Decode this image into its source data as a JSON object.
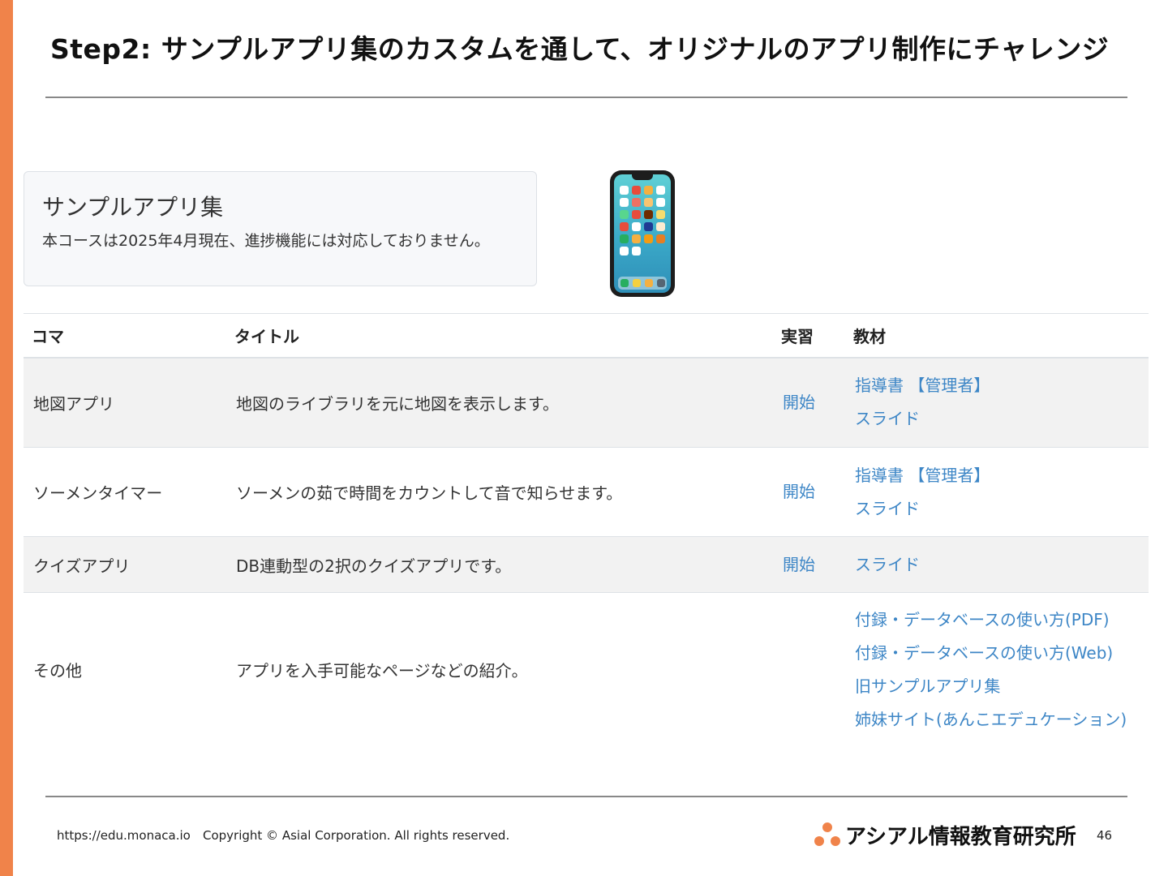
{
  "slide": {
    "title": "Step2: サンプルアプリ集のカスタムを通して、オリジナルのアプリ制作にチャレンジ",
    "accent_color": "#f0834a"
  },
  "info_box": {
    "heading": "サンプルアプリ集",
    "note": "本コースは2025年4月現在、進捗機能には対応しておりません。"
  },
  "phone_image": {
    "icon": "smartphone-home-screen-icon"
  },
  "table": {
    "headers": {
      "koma": "コマ",
      "title": "タイトル",
      "jissyu": "実習",
      "kyozai": "教材"
    },
    "rows": [
      {
        "koma": "地図アプリ",
        "title": "地図のライブラリを元に地図を表示します。",
        "start": "開始",
        "materials": [
          "指導書 【管理者】",
          "スライド"
        ]
      },
      {
        "koma": "ソーメンタイマー",
        "title": "ソーメンの茹で時間をカウントして音で知らせます。",
        "start": "開始",
        "materials": [
          "指導書 【管理者】",
          "スライド"
        ]
      },
      {
        "koma": "クイズアプリ",
        "title": "DB連動型の2択のクイズアプリです。",
        "start": "開始",
        "materials": [
          "スライド"
        ]
      },
      {
        "koma": "その他",
        "title": "アプリを入手可能なページなどの紹介。",
        "start": "",
        "materials": [
          "付録・データベースの使い方(PDF)",
          "付録・データベースの使い方(Web)",
          "旧サンプルアプリ集",
          "姉妹サイト(あんこエデュケーション)"
        ]
      }
    ],
    "link_color": "#3d86c6"
  },
  "footer": {
    "url": "https://edu.monaca.io",
    "copyright": "Copyright © Asial Corporation. All rights reserved.",
    "logo_text": "アシアル情報教育研究所",
    "page_number": "46"
  }
}
